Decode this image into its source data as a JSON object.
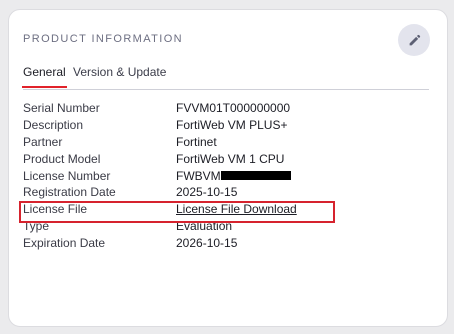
{
  "card": {
    "title": "PRODUCT INFORMATION",
    "edit_icon": "pencil-icon"
  },
  "tabs": [
    {
      "label": "General",
      "active": true
    },
    {
      "label": "Version & Update",
      "active": false
    }
  ],
  "rows": [
    {
      "label": "Serial Number",
      "value": "FVVM01T000000000"
    },
    {
      "label": "Description",
      "value": "FortiWeb VM PLUS+"
    },
    {
      "label": "Partner",
      "value": "Fortinet"
    },
    {
      "label": "Product Model",
      "value": "FortiWeb VM 1 CPU"
    },
    {
      "label": "License Number",
      "value": "FWBVM"
    },
    {
      "label": "Registration Date",
      "value": "2025-10-15"
    },
    {
      "label": "License File",
      "value": "License File Download"
    },
    {
      "label": "Type",
      "value": "Evaluation"
    },
    {
      "label": "Expiration Date",
      "value": "2026-10-15"
    }
  ],
  "colors": {
    "accent_red": "#e1222a",
    "link_blue": "#1d4fb4",
    "highlight_red": "#d6232e"
  }
}
